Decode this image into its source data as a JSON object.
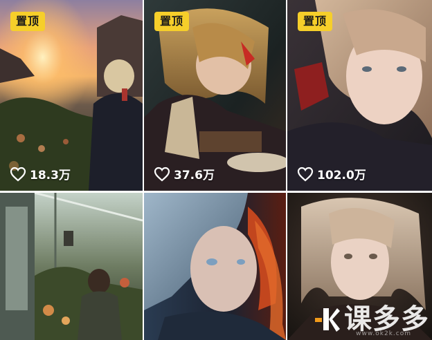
{
  "tiles": [
    {
      "pinned_label": "置顶",
      "likes": "18.3万"
    },
    {
      "pinned_label": "置顶",
      "likes": "37.6万"
    },
    {
      "pinned_label": "置顶",
      "likes": "102.0万"
    },
    {},
    {},
    {}
  ],
  "watermark": {
    "text": "课多多",
    "sub": "www.ok2k.com"
  },
  "colors": {
    "badge": "#f6cf2a",
    "text": "#ffffff",
    "logo_accent": "#f29a1a"
  }
}
